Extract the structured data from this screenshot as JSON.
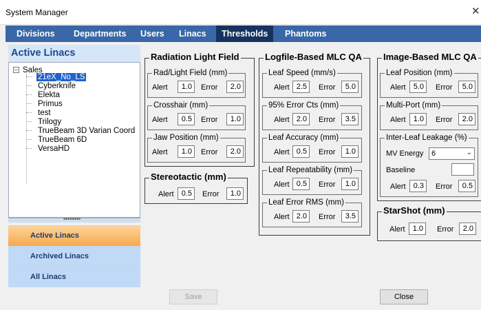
{
  "window": {
    "title": "System Manager",
    "close_glyph": "✕"
  },
  "menu": [
    {
      "label": "Divisions"
    },
    {
      "label": "Departments"
    },
    {
      "label": "Users"
    },
    {
      "label": "Linacs"
    },
    {
      "label": "Thresholds",
      "active": true
    },
    {
      "label": "Phantoms"
    }
  ],
  "left_panel": {
    "header": "Active Linacs",
    "tree": {
      "root": "Sales",
      "items": [
        "21eX_No_LS",
        "Cyberknife",
        "Elekta",
        "Primus",
        "test",
        "Trilogy",
        "TrueBeam 3D Varian Coord",
        "TrueBeam 6D",
        "VersaHD"
      ],
      "selected": "21eX_No_LS"
    },
    "splitter_dots": "••••••••",
    "nav": [
      "Active Linacs",
      "Archived Linacs",
      "All Linacs"
    ]
  },
  "labels": {
    "alert": "Alert",
    "error": "Error",
    "mv_energy": "MV Energy",
    "baseline": "Baseline"
  },
  "groups": {
    "radiation_light_field": {
      "title": "Radiation Light Field",
      "rad_light": {
        "title": "Rad/Light Field (mm)",
        "alert": "1.0",
        "error": "2.0"
      },
      "crosshair": {
        "title": "Crosshair (mm)",
        "alert": "0.5",
        "error": "1.0"
      },
      "jaw_position": {
        "title": "Jaw Position (mm)",
        "alert": "1.0",
        "error": "2.0"
      }
    },
    "stereotactic": {
      "title": "Stereotactic (mm)",
      "alert": "0.5",
      "error": "1.0"
    },
    "logfile_mlc": {
      "title": "Logfile-Based MLC QA",
      "leaf_speed": {
        "title": "Leaf Speed (mm/s)",
        "alert": "2.5",
        "error": "5.0"
      },
      "error_cts": {
        "title": "95% Error Cts (mm)",
        "alert": "2.0",
        "error": "3.5"
      },
      "leaf_accuracy": {
        "title": "Leaf Accuracy (mm)",
        "alert": "0.5",
        "error": "1.0"
      },
      "leaf_repeatability": {
        "title": "Leaf Repeatability (mm)",
        "alert": "0.5",
        "error": "1.0"
      },
      "leaf_error_rms": {
        "title": "Leaf Error RMS (mm)",
        "alert": "2.0",
        "error": "3.5"
      }
    },
    "image_mlc": {
      "title": "Image-Based MLC QA",
      "leaf_position": {
        "title": "Leaf Position (mm)",
        "alert": "5.0",
        "error": "5.0"
      },
      "multi_port": {
        "title": "Multi-Port (mm)",
        "alert": "1.0",
        "error": "2.0"
      },
      "inter_leaf": {
        "title": "Inter-Leaf Leakage (%)",
        "mv_energy": "6",
        "baseline": "",
        "alert": "0.3",
        "error": "0.5"
      }
    },
    "starshot": {
      "title": "StarShot (mm)",
      "alert": "1.0",
      "error": "2.0"
    }
  },
  "buttons": {
    "save": "Save",
    "close": "Close"
  },
  "colors": {
    "menubar": "#3a67a8",
    "menu_active": "#16335f",
    "selection": "#1f62c9",
    "nav_active": "#f6a94e",
    "nav_inactive": "#bfd9f7"
  }
}
